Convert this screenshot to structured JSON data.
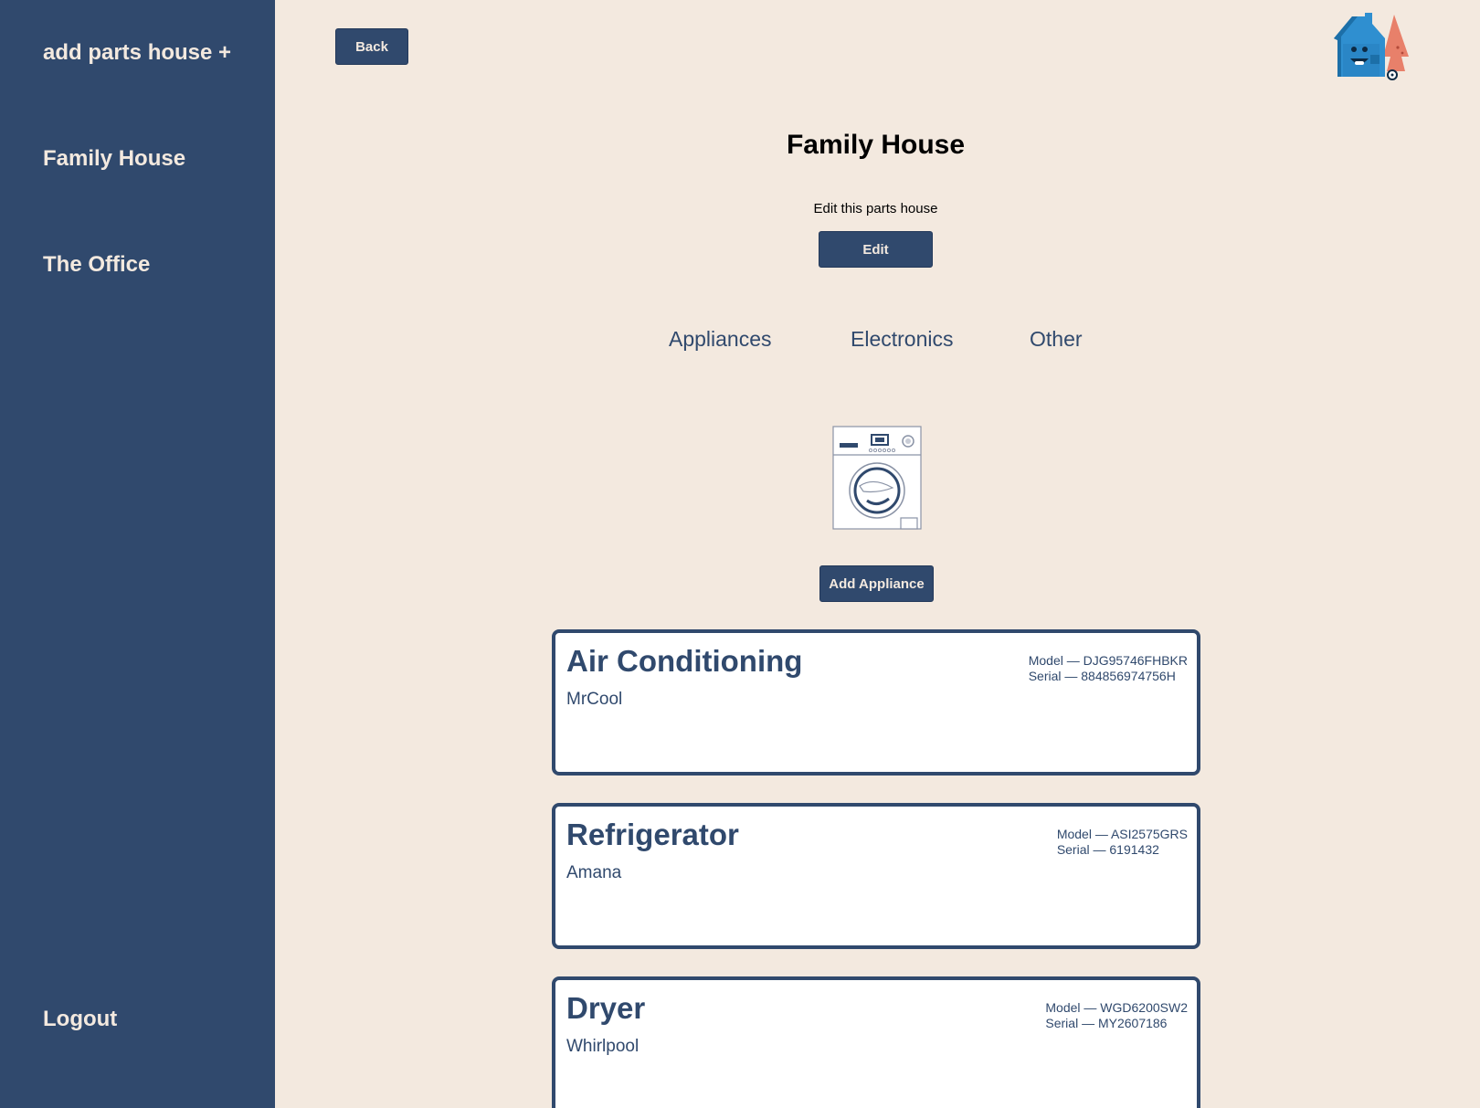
{
  "sidebar": {
    "add_house": "add parts house +",
    "houses": [
      "Family House",
      "The Office"
    ],
    "logout": "Logout"
  },
  "header": {
    "back_label": "Back"
  },
  "house": {
    "title": "Family House",
    "edit_caption": "Edit this parts house",
    "edit_label": "Edit"
  },
  "tabs": [
    "Appliances",
    "Electronics",
    "Other"
  ],
  "add_appliance_label": "Add Appliance",
  "appliances": [
    {
      "name": "Air Conditioning",
      "brand": "MrCool",
      "model": "Model — DJG95746FHBKR",
      "serial": "Serial — 884856974756H"
    },
    {
      "name": "Refrigerator",
      "brand": "Amana",
      "model": "Model — ASI2575GRS",
      "serial": "Serial — 6191432"
    },
    {
      "name": "Dryer",
      "brand": "Whirlpool",
      "model": "Model — WGD6200SW2",
      "serial": "Serial — MY2607186"
    }
  ],
  "colors": {
    "sidebar": "#30496d",
    "background": "#f3e9df",
    "accent": "#30496d",
    "card": "#ffffff"
  },
  "icons": {
    "logo": "house-mascot-logo",
    "hero": "washing-machine-icon"
  }
}
